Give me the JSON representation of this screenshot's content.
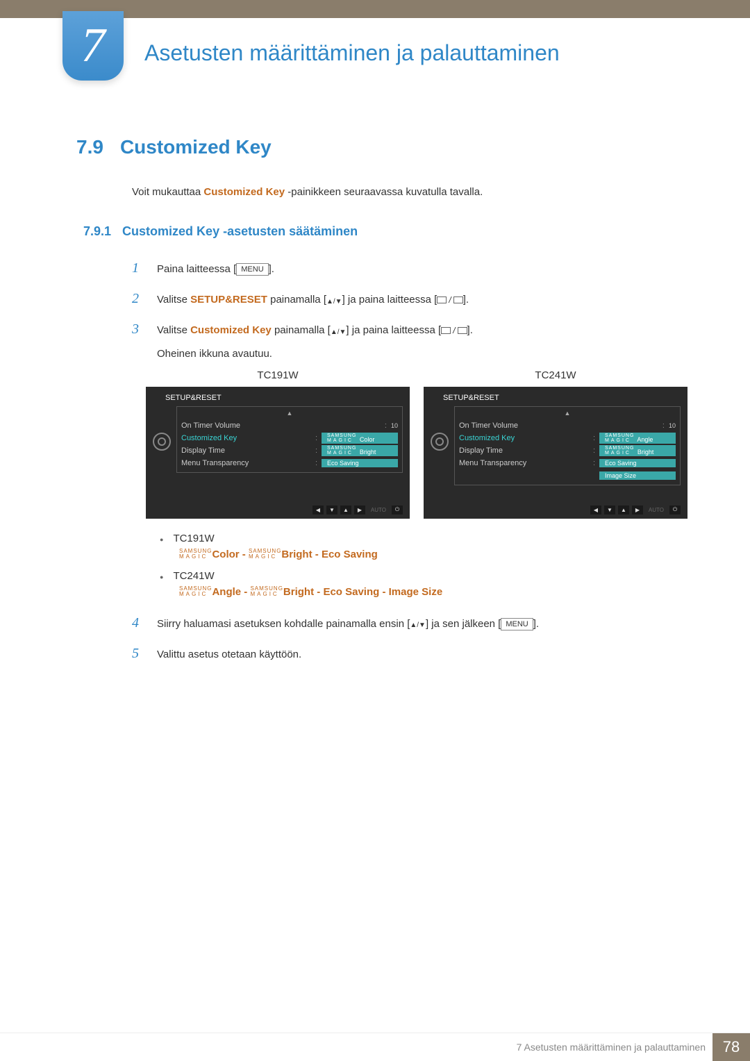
{
  "chapter": {
    "number": "7",
    "title": "Asetusten määrittäminen ja palauttaminen"
  },
  "section": {
    "number": "7.9",
    "title": "Customized Key"
  },
  "intro": {
    "pre": "Voit mukauttaa ",
    "kw": "Customized Key",
    "post": " -painikkeen seuraavassa kuvatulla tavalla."
  },
  "subsection": {
    "number": "7.9.1",
    "title": "Customized Key -asetusten säätäminen"
  },
  "steps": {
    "s1": {
      "n": "1",
      "pre": "Paina laitteessa [",
      "menu": "MENU",
      "post": "]."
    },
    "s2": {
      "n": "2",
      "pre": "Valitse ",
      "kw": "SETUP&RESET",
      "mid": " painamalla [",
      "end": "] ja paina laitteessa [",
      "close": "]."
    },
    "s3": {
      "n": "3",
      "pre": "Valitse ",
      "kw": "Customized Key",
      "mid": " painamalla [",
      "end": "] ja paina laitteessa [",
      "close": "].",
      "after": "Oheinen ikkuna avautuu."
    },
    "s4": {
      "n": "4",
      "text": "Siirry haluamasi asetuksen kohdalle painamalla ensin [",
      "mid": "] ja sen jälkeen [",
      "menu": "MENU",
      "close": "]."
    },
    "s5": {
      "n": "5",
      "text": "Valittu asetus otetaan käyttöön."
    }
  },
  "osd": {
    "left_model": "TC191W",
    "right_model": "TC241W",
    "header": "SETUP&RESET",
    "items": {
      "on_timer_volume": "On Timer Volume",
      "customized_key": "Customized Key",
      "display_time": "Display Time",
      "menu_transparency": "Menu Transparency"
    },
    "values": {
      "volume": "10",
      "magic_prefix_top": "SAMSUNG",
      "magic_prefix_bottom": "MAGIC",
      "magic_color": "Color",
      "magic_bright": "Bright",
      "magic_angle": "Angle",
      "eco_saving": "Eco Saving",
      "image_size": "Image Size"
    },
    "nav": {
      "auto": "AUTO"
    }
  },
  "options": {
    "tc191w": "TC191W",
    "tc241w": "TC241W",
    "line1": {
      "color": "Color",
      "bright": "Bright",
      "eco": "Eco Saving",
      "dash": " - "
    },
    "line2": {
      "angle": "Angle",
      "bright": "Bright",
      "eco": "Eco Saving",
      "img": "Image Size",
      "dash": " - "
    }
  },
  "footer": {
    "text": "7 Asetusten määrittäminen ja palauttaminen",
    "page": "78"
  }
}
